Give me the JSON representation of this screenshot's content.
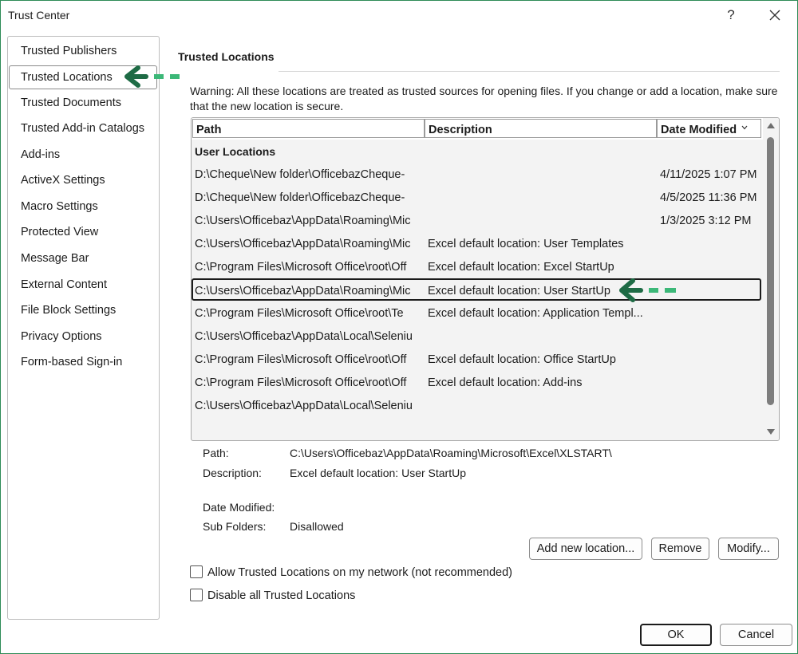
{
  "window": {
    "title": "Trust Center",
    "help_label": "?"
  },
  "sidebar": {
    "items": [
      {
        "label": "Trusted Publishers"
      },
      {
        "label": "Trusted Locations",
        "active": true
      },
      {
        "label": "Trusted Documents"
      },
      {
        "label": "Trusted Add-in Catalogs"
      },
      {
        "label": "Add-ins"
      },
      {
        "label": "ActiveX Settings"
      },
      {
        "label": "Macro Settings"
      },
      {
        "label": "Protected View"
      },
      {
        "label": "Message Bar"
      },
      {
        "label": "External Content"
      },
      {
        "label": "File Block Settings"
      },
      {
        "label": "Privacy Options"
      },
      {
        "label": "Form-based Sign-in"
      }
    ]
  },
  "main": {
    "section_title": "Trusted Locations",
    "warning": "Warning: All these locations are treated as trusted sources for opening files.  If you change or add a location, make sure that the new location is secure."
  },
  "table": {
    "columns": [
      "Path",
      "Description",
      "Date Modified"
    ],
    "sort_icon": "chevron-down-icon",
    "group_label": "User Locations",
    "rows": [
      {
        "path": "D:\\Cheque\\New folder\\OfficebazCheque-",
        "description": "",
        "date": "4/11/2025 1:07 PM"
      },
      {
        "path": "D:\\Cheque\\New folder\\OfficebazCheque-",
        "description": "",
        "date": "4/5/2025 11:36 PM"
      },
      {
        "path": "C:\\Users\\Officebaz\\AppData\\Roaming\\Mic",
        "description": "",
        "date": "1/3/2025 3:12 PM"
      },
      {
        "path": "C:\\Users\\Officebaz\\AppData\\Roaming\\Mic",
        "description": "Excel default location: User Templates",
        "date": ""
      },
      {
        "path": "C:\\Program Files\\Microsoft Office\\root\\Off",
        "description": "Excel default location: Excel StartUp",
        "date": ""
      },
      {
        "path": "C:\\Users\\Officebaz\\AppData\\Roaming\\Mic",
        "description": "Excel default location: User StartUp",
        "date": "",
        "selected": true
      },
      {
        "path": "C:\\Program Files\\Microsoft Office\\root\\Te",
        "description": "Excel default location: Application Templ...",
        "date": ""
      },
      {
        "path": "C:\\Users\\Officebaz\\AppData\\Local\\Seleniu",
        "description": "",
        "date": ""
      },
      {
        "path": "C:\\Program Files\\Microsoft Office\\root\\Off",
        "description": "Excel default location: Office StartUp",
        "date": ""
      },
      {
        "path": "C:\\Program Files\\Microsoft Office\\root\\Off",
        "description": "Excel default location: Add-ins",
        "date": ""
      },
      {
        "path": "C:\\Users\\Officebaz\\AppData\\Local\\Seleniu",
        "description": "",
        "date": ""
      }
    ]
  },
  "details": {
    "path_label": "Path:",
    "path_value": "C:\\Users\\Officebaz\\AppData\\Roaming\\Microsoft\\Excel\\XLSTART\\",
    "description_label": "Description:",
    "description_value": "Excel default location: User StartUp",
    "date_label": "Date Modified:",
    "date_value": "",
    "subfolders_label": "Sub Folders:",
    "subfolders_value": "Disallowed"
  },
  "buttons": {
    "add": "Add new location...",
    "remove": "Remove",
    "modify": "Modify...",
    "ok": "OK",
    "cancel": "Cancel"
  },
  "options": {
    "allow_network_label": "Allow Trusted Locations on my network (not recommended)",
    "allow_network_checked": false,
    "disable_all_label": "Disable all Trusted Locations",
    "disable_all_checked": false
  },
  "colors": {
    "annotation_arrow": "#1e6b45",
    "annotation_dash": "#3cb878",
    "window_border": "#2e8b57"
  }
}
